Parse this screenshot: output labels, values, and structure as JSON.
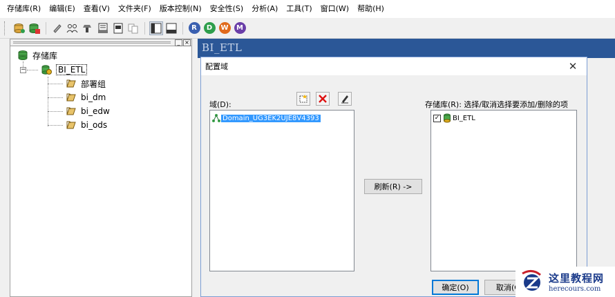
{
  "menu": [
    "存储库(R)",
    "编辑(E)",
    "查看(V)",
    "文件夹(F)",
    "版本控制(N)",
    "安全性(S)",
    "分析(A)",
    "工具(T)",
    "窗口(W)",
    "帮助(H)"
  ],
  "toolbar": {
    "round_buttons": [
      "R",
      "D",
      "W",
      "M"
    ],
    "round_colors": [
      "#3a5fb0",
      "#2e9e4c",
      "#e06a1c",
      "#6a3ea8"
    ]
  },
  "tree": {
    "root_label": "存储库",
    "repo_label": "BI_ETL",
    "folders": [
      "部署组",
      "bi_dm",
      "bi_edw",
      "bi_ods"
    ]
  },
  "document": {
    "title": "BI_ETL"
  },
  "dialog": {
    "title": "配置域",
    "domain_label": "域(D):",
    "domain_items": [
      "Domain_UG3EK2UJE8V4393"
    ],
    "repo_label": "存储库(R): 选择/取消选择要添加/删除的项",
    "repo_items": [
      {
        "label": "BI_ETL",
        "checked": true
      }
    ],
    "refresh_button": "刷新(R) ->",
    "ok_button": "确定(O)",
    "cancel_button": "取消(C"
  },
  "watermark": {
    "title": "这里教程网",
    "url": "herecours.com"
  },
  "colors": {
    "doc_header": "#2b5797",
    "selection": "#3399ff"
  }
}
